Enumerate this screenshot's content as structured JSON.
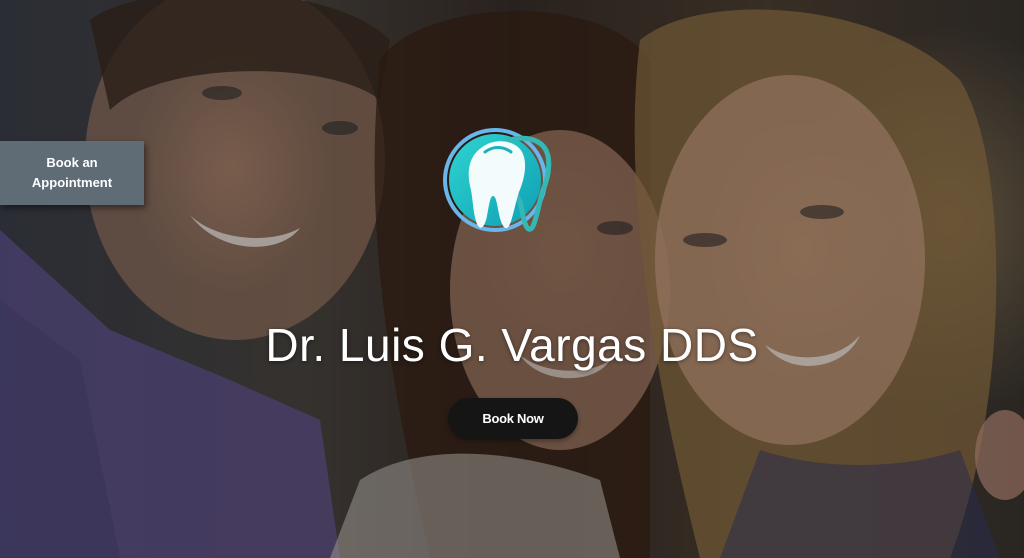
{
  "hero": {
    "background_image": "smiling-people-photo",
    "title": "Dr. Luis G. Vargas DDS",
    "cta_label": "Book Now"
  },
  "side_tab": {
    "label": "Book an Appointment"
  },
  "logo": {
    "icon": "tooth-icon"
  },
  "colors": {
    "tab_bg": "#5f6b75",
    "cta_bg": "#151515",
    "logo_teal": "#1fb8c2",
    "logo_ring": "#5fb3e6"
  }
}
